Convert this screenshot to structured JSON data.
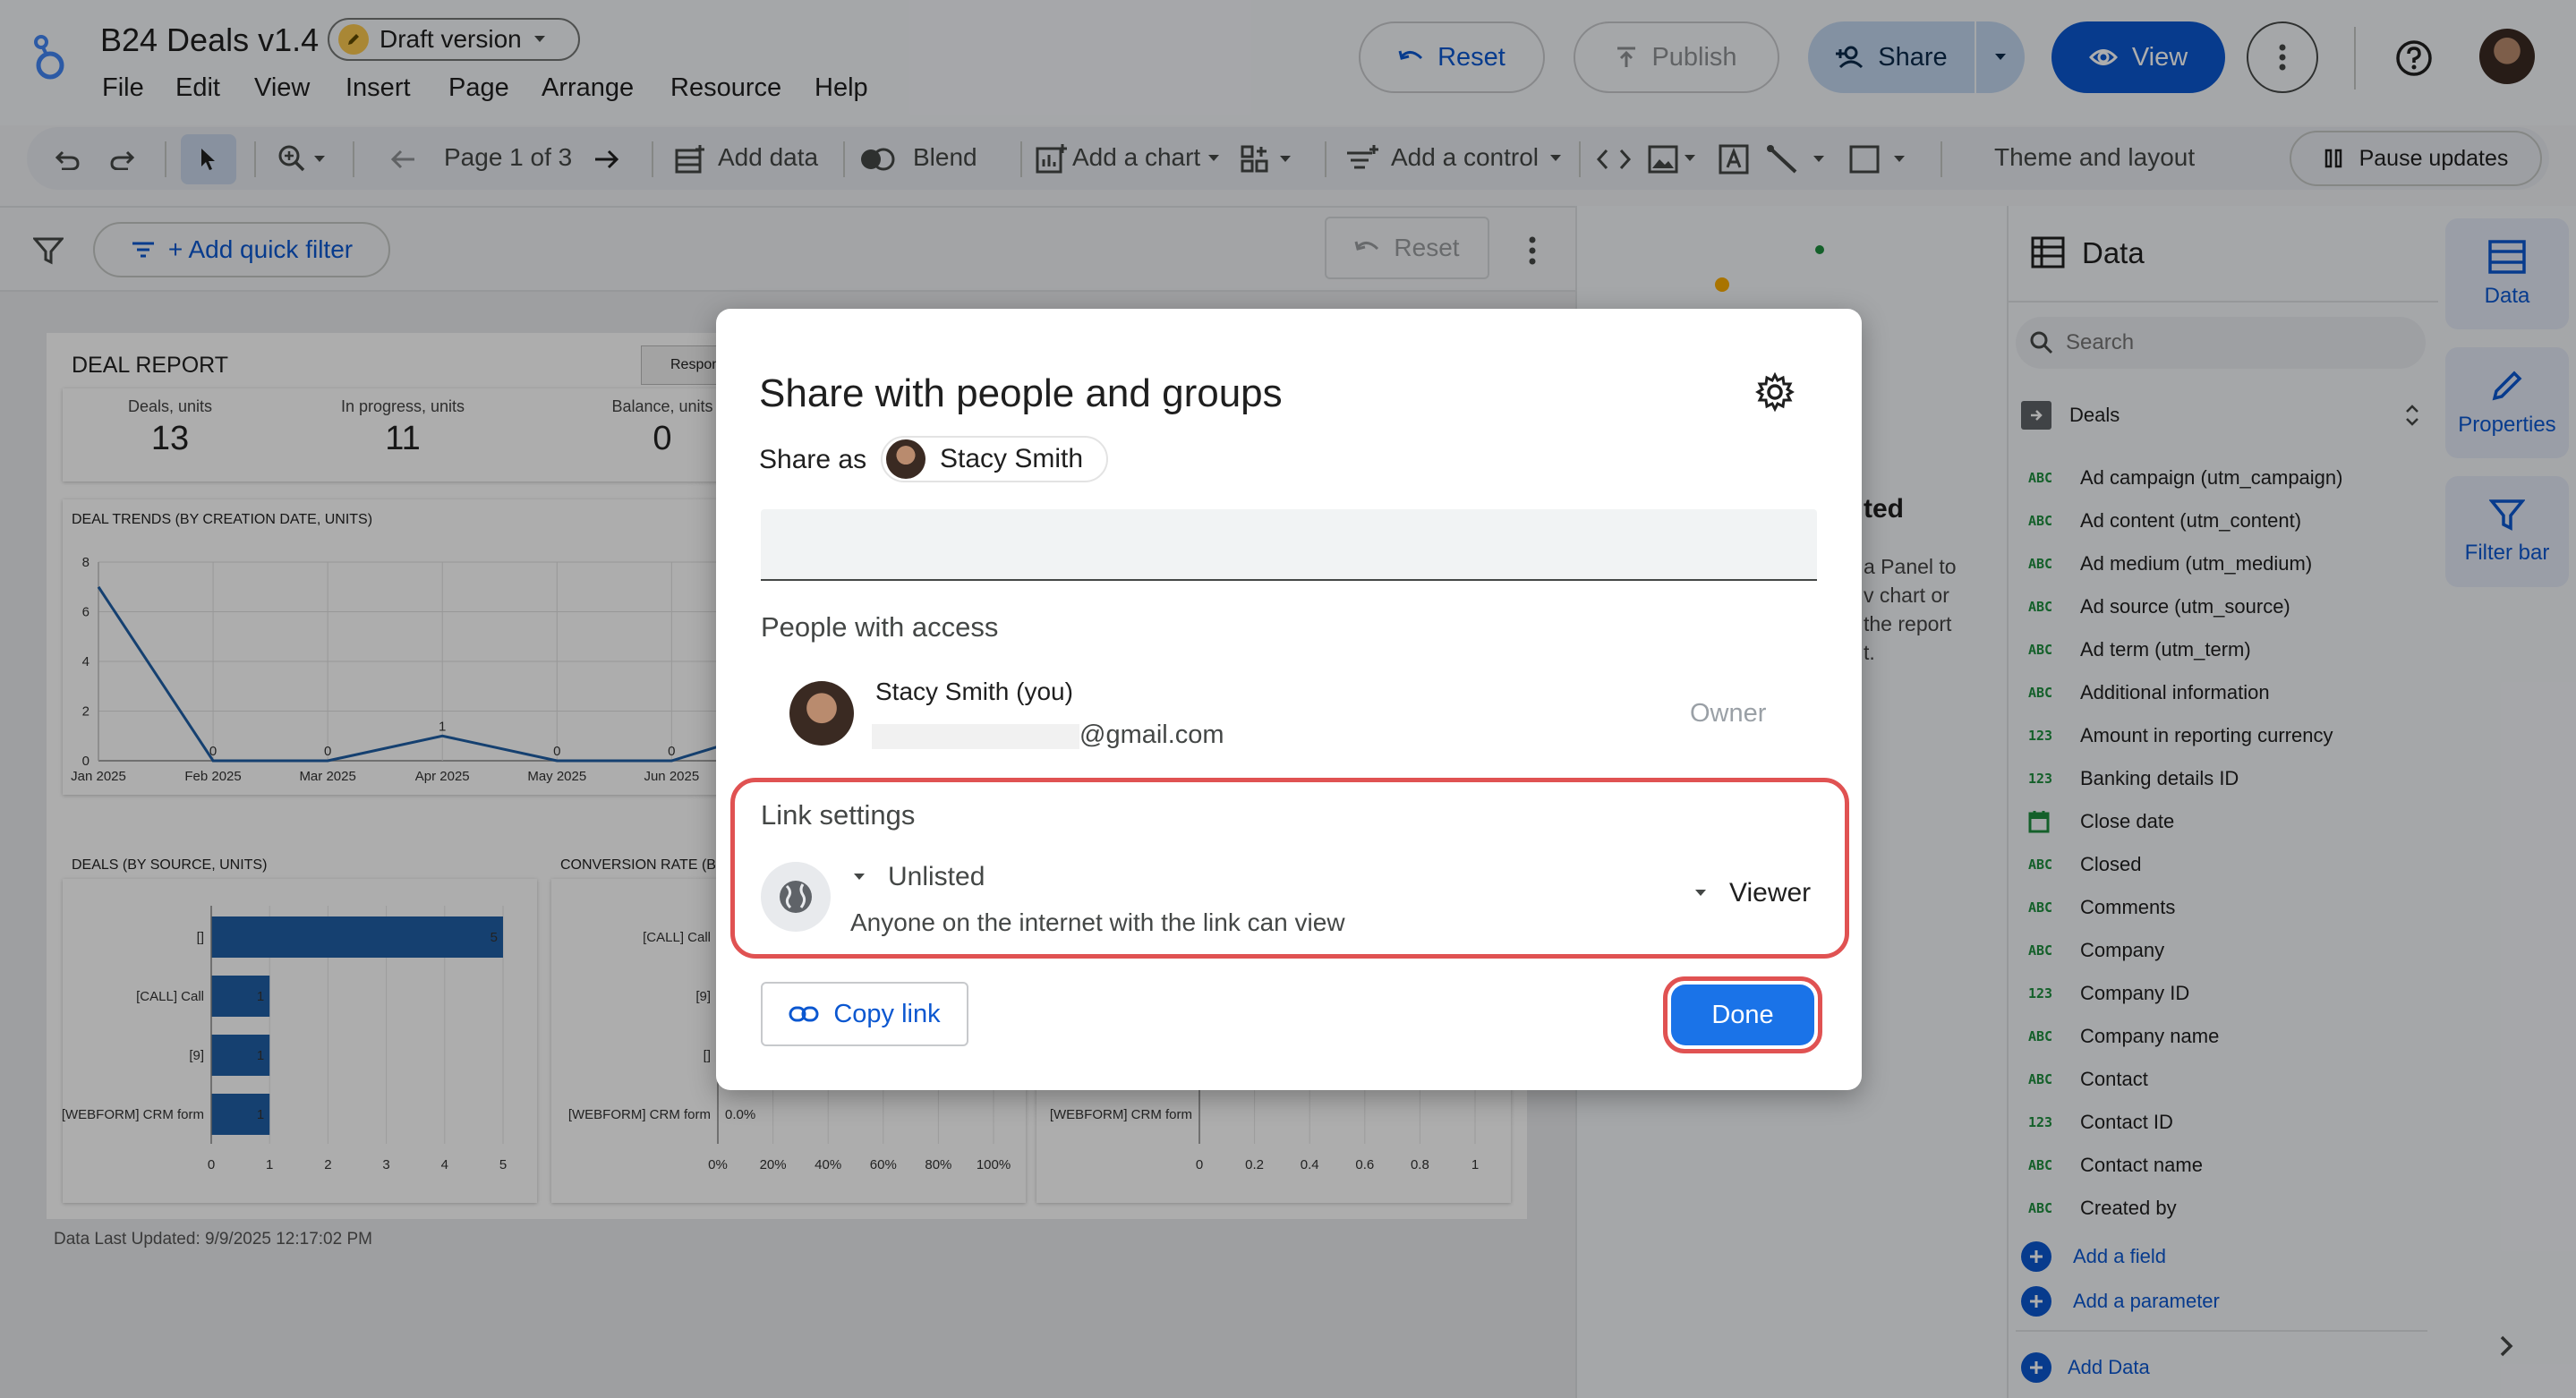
{
  "app": {
    "title": "B24 Deals v1.4",
    "draft_badge": "Draft version"
  },
  "menu": [
    "File",
    "Edit",
    "View",
    "Insert",
    "Page",
    "Arrange",
    "Resource",
    "Help"
  ],
  "header_buttons": {
    "reset": "Reset",
    "publish": "Publish",
    "share": "Share",
    "view": "View"
  },
  "toolbar": {
    "page_indicator": "Page 1 of 3",
    "add_data": "Add data",
    "blend": "Blend",
    "add_chart": "Add a chart",
    "add_control": "Add a control",
    "theme_layout": "Theme and layout",
    "pause_updates": "Pause updates"
  },
  "filterbar": {
    "add_quick_filter": "+ Add quick filter",
    "reset": "Reset"
  },
  "report": {
    "title": "DEAL REPORT",
    "tab_label": "Respon",
    "kpis": [
      {
        "label": "Deals, units",
        "value": "13"
      },
      {
        "label": "In progress, units",
        "value": "11"
      },
      {
        "label": "Balance, units",
        "value": "0"
      }
    ],
    "footer": "Data Last Updated: 9/9/2025 12:17:02 PM"
  },
  "chart_data": [
    {
      "type": "line",
      "title": "DEAL TRENDS (BY CREATION DATE, UNITS)",
      "categories": [
        "Jan 2025",
        "Feb 2025",
        "Mar 2025",
        "Apr 2025",
        "May 2025",
        "Jun 2025"
      ],
      "values": [
        7,
        0,
        0,
        1,
        0,
        0
      ],
      "data_labels": [
        "",
        "0",
        "0",
        "1",
        "0",
        "0"
      ],
      "yticks": [
        "0",
        "2",
        "4",
        "6",
        "8"
      ],
      "ylim": [
        0,
        8
      ],
      "grid": true
    },
    {
      "type": "bar",
      "orientation": "horizontal",
      "title": "DEALS (BY SOURCE, UNITS)",
      "categories": [
        "[]",
        "[CALL] Call",
        "[9]",
        "[WEBFORM] CRM form"
      ],
      "values": [
        5,
        1,
        1,
        1
      ],
      "xticks": [
        "0",
        "1",
        "2",
        "3",
        "4",
        "5"
      ],
      "xlim": [
        0,
        5
      ]
    },
    {
      "type": "bar",
      "orientation": "horizontal",
      "title": "CONVERSION RATE (BY",
      "categories": [
        "[CALL] Call",
        "[9]",
        "[]",
        "[WEBFORM] CRM form"
      ],
      "data_labels": [
        "",
        "",
        "",
        "0.0%"
      ],
      "xticks": [
        "0%",
        "20%",
        "40%",
        "60%",
        "80%",
        "100%"
      ]
    },
    {
      "type": "bar",
      "orientation": "horizontal",
      "categories": [
        "[WEBFORM] CRM form"
      ],
      "xticks": [
        "0",
        "0.2",
        "0.4",
        "0.6",
        "0.8",
        "1"
      ]
    }
  ],
  "empty_panel": {
    "title_fragment": "ted",
    "lines": [
      "a Panel to",
      "v chart or",
      "the report",
      "t."
    ]
  },
  "data_panel": {
    "title": "Data",
    "search_placeholder": "Search",
    "source_name": "Deals",
    "fields": [
      {
        "type": "ABC",
        "name": "Ad campaign (utm_campaign)"
      },
      {
        "type": "ABC",
        "name": "Ad content (utm_content)"
      },
      {
        "type": "ABC",
        "name": "Ad medium (utm_medium)"
      },
      {
        "type": "ABC",
        "name": "Ad source (utm_source)"
      },
      {
        "type": "ABC",
        "name": "Ad term (utm_term)"
      },
      {
        "type": "ABC",
        "name": "Additional information"
      },
      {
        "type": "123",
        "name": "Amount in reporting currency"
      },
      {
        "type": "123",
        "name": "Banking details ID"
      },
      {
        "type": "date",
        "name": "Close date"
      },
      {
        "type": "ABC",
        "name": "Closed"
      },
      {
        "type": "ABC",
        "name": "Comments"
      },
      {
        "type": "ABC",
        "name": "Company"
      },
      {
        "type": "123",
        "name": "Company ID"
      },
      {
        "type": "ABC",
        "name": "Company name"
      },
      {
        "type": "ABC",
        "name": "Contact"
      },
      {
        "type": "123",
        "name": "Contact ID"
      },
      {
        "type": "ABC",
        "name": "Contact name"
      },
      {
        "type": "ABC",
        "name": "Created by"
      }
    ],
    "add_field": "Add a field",
    "add_parameter": "Add a parameter",
    "add_data": "Add Data"
  },
  "rail": {
    "data": "Data",
    "properties": "Properties",
    "filter_bar": "Filter bar"
  },
  "dialog": {
    "title": "Share with people and groups",
    "share_as_label": "Share as",
    "share_as_user": "Stacy Smith",
    "people_heading": "People with access",
    "person_name": "Stacy Smith (you)",
    "person_email": "@gmail.com",
    "person_role": "Owner",
    "link_heading": "Link settings",
    "link_access": "Unlisted",
    "link_description": "Anyone on the internet with the link can view",
    "link_role": "Viewer",
    "copy_link": "Copy link",
    "done": "Done"
  },
  "colors": {
    "accent": "#0b57d0",
    "done_button": "#1a73e8",
    "highlight": "#e05252",
    "chart_blue": "#1f5fa6",
    "field_type_green": "#1e8e3e"
  }
}
